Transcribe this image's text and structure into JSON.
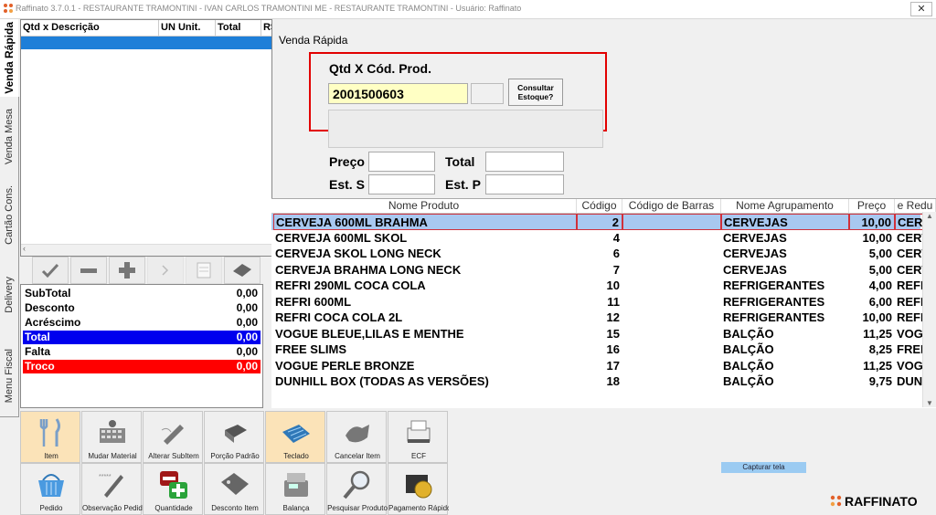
{
  "window": {
    "title": "Raffinato 3.7.0.1 - RESTAURANTE TRAMONTINI - IVAN CARLOS TRAMONTINI ME - RESTAURANTE TRAMONTINI - Usuário: Raffinato",
    "close_label": "✕"
  },
  "side_tabs": [
    {
      "label": "Venda Rápida",
      "active": true
    },
    {
      "label": "Venda Mesa",
      "active": false
    },
    {
      "label": "Cartão Cons.",
      "active": false
    },
    {
      "label": "Delivery",
      "active": false
    },
    {
      "label": "Menu Fiscal",
      "active": false
    }
  ],
  "order_grid": {
    "columns": [
      "Qtd x Descrição",
      "UN Unit.",
      "Total",
      "R$"
    ]
  },
  "action_icons": [
    "ok-icon",
    "minus-icon",
    "plus-icon",
    "arrow-icon",
    "receipt-icon",
    "tag-icon"
  ],
  "totals": [
    {
      "label": "SubTotal",
      "value": "0,00",
      "color": "#ffffff",
      "text": "#000000"
    },
    {
      "label": "Desconto",
      "value": "0,00",
      "color": "#ffffff",
      "text": "#000000"
    },
    {
      "label": "Acréscimo",
      "value": "0,00",
      "color": "#ffffff",
      "text": "#000000"
    },
    {
      "label": "Total",
      "value": "0,00",
      "color": "#0000ee",
      "text": "#ffffff"
    },
    {
      "label": "Falta",
      "value": "0,00",
      "color": "#ffffff",
      "text": "#000000"
    },
    {
      "label": "Troco",
      "value": "0,00",
      "color": "#ff0000",
      "text": "#ffffff"
    }
  ],
  "toolbar": [
    {
      "label": "Item",
      "icon": "cutlery-icon",
      "active": true
    },
    {
      "label": "Mudar Material",
      "icon": "keyboard-grid-icon",
      "active": false
    },
    {
      "label": "Alterar SubItem",
      "icon": "pencil-icon",
      "active": false
    },
    {
      "label": "Porção Padrão",
      "icon": "portion-icon",
      "active": false
    },
    {
      "label": "Teclado",
      "icon": "keyboard-icon",
      "active": true
    },
    {
      "label": "Cancelar Item",
      "icon": "cancel-hand-icon",
      "active": false
    },
    {
      "label": "ECF",
      "icon": "printer-icon",
      "active": false
    },
    {
      "label": "Pedido",
      "icon": "basket-icon",
      "active": false
    },
    {
      "label": "Observação Pedido",
      "icon": "note-pen-icon",
      "active": false
    },
    {
      "label": "Quantidade",
      "icon": "quantity-plus-minus-icon",
      "active": false
    },
    {
      "label": "Desconto Item",
      "icon": "discount-tag-icon",
      "active": false
    },
    {
      "label": "Balança",
      "icon": "scale-icon",
      "active": false
    },
    {
      "label": "Pesquisar Produto",
      "icon": "magnifier-icon",
      "active": false
    },
    {
      "label": "Pagamento Rápido",
      "icon": "payment-icon",
      "active": false
    }
  ],
  "venda_rapida": {
    "title": "Venda Rápida",
    "qtd_label": "Qtd X Cód. Prod.",
    "qtd_value": "2001500603",
    "consultar_label": "Consultar Estoque?",
    "preco_label": "Preço",
    "total_label": "Total",
    "est_s_label": "Est. S",
    "est_p_label": "Est. P"
  },
  "products": {
    "columns": [
      "Nome Produto",
      "Código",
      "Código de Barras",
      "Nome Agrupamento",
      "Preço",
      "e Redu"
    ],
    "rows": [
      {
        "nome": "CERVEJA 600ML BRAHMA",
        "codigo": "2",
        "barras": "",
        "grupo": "CERVEJAS",
        "preco": "10,00",
        "red": "CERV"
      },
      {
        "nome": "CERVEJA 600ML SKOL",
        "codigo": "4",
        "barras": "",
        "grupo": "CERVEJAS",
        "preco": "10,00",
        "red": "CERV"
      },
      {
        "nome": "CERVEJA SKOL LONG NECK",
        "codigo": "6",
        "barras": "",
        "grupo": "CERVEJAS",
        "preco": "5,00",
        "red": "CERV"
      },
      {
        "nome": "CERVEJA BRAHMA LONG NECK",
        "codigo": "7",
        "barras": "",
        "grupo": "CERVEJAS",
        "preco": "5,00",
        "red": "CERV"
      },
      {
        "nome": "REFRI 290ML COCA COLA",
        "codigo": "10",
        "barras": "",
        "grupo": "REFRIGERANTES",
        "preco": "4,00",
        "red": "REFI"
      },
      {
        "nome": "REFRI 600ML",
        "codigo": "11",
        "barras": "",
        "grupo": "REFRIGERANTES",
        "preco": "6,00",
        "red": "REFI"
      },
      {
        "nome": "REFRI COCA COLA 2L",
        "codigo": "12",
        "barras": "",
        "grupo": "REFRIGERANTES",
        "preco": "10,00",
        "red": "REFI"
      },
      {
        "nome": "VOGUE BLEUE,LILAS E MENTHE",
        "codigo": "15",
        "barras": "",
        "grupo": "BALÇÃO",
        "preco": "11,25",
        "red": "VOG"
      },
      {
        "nome": "FREE SLIMS",
        "codigo": "16",
        "barras": "",
        "grupo": "BALÇÃO",
        "preco": "8,25",
        "red": "FREE"
      },
      {
        "nome": "VOGUE PERLE BRONZE",
        "codigo": "17",
        "barras": "",
        "grupo": "BALÇÃO",
        "preco": "11,25",
        "red": "VOG"
      },
      {
        "nome": "DUNHILL BOX (TODAS AS VERSÕES)",
        "codigo": "18",
        "barras": "",
        "grupo": "BALÇÃO",
        "preco": "9,75",
        "red": "DUN"
      }
    ]
  },
  "capture_button": "Capturar tela",
  "brand": "RAFFINATO"
}
